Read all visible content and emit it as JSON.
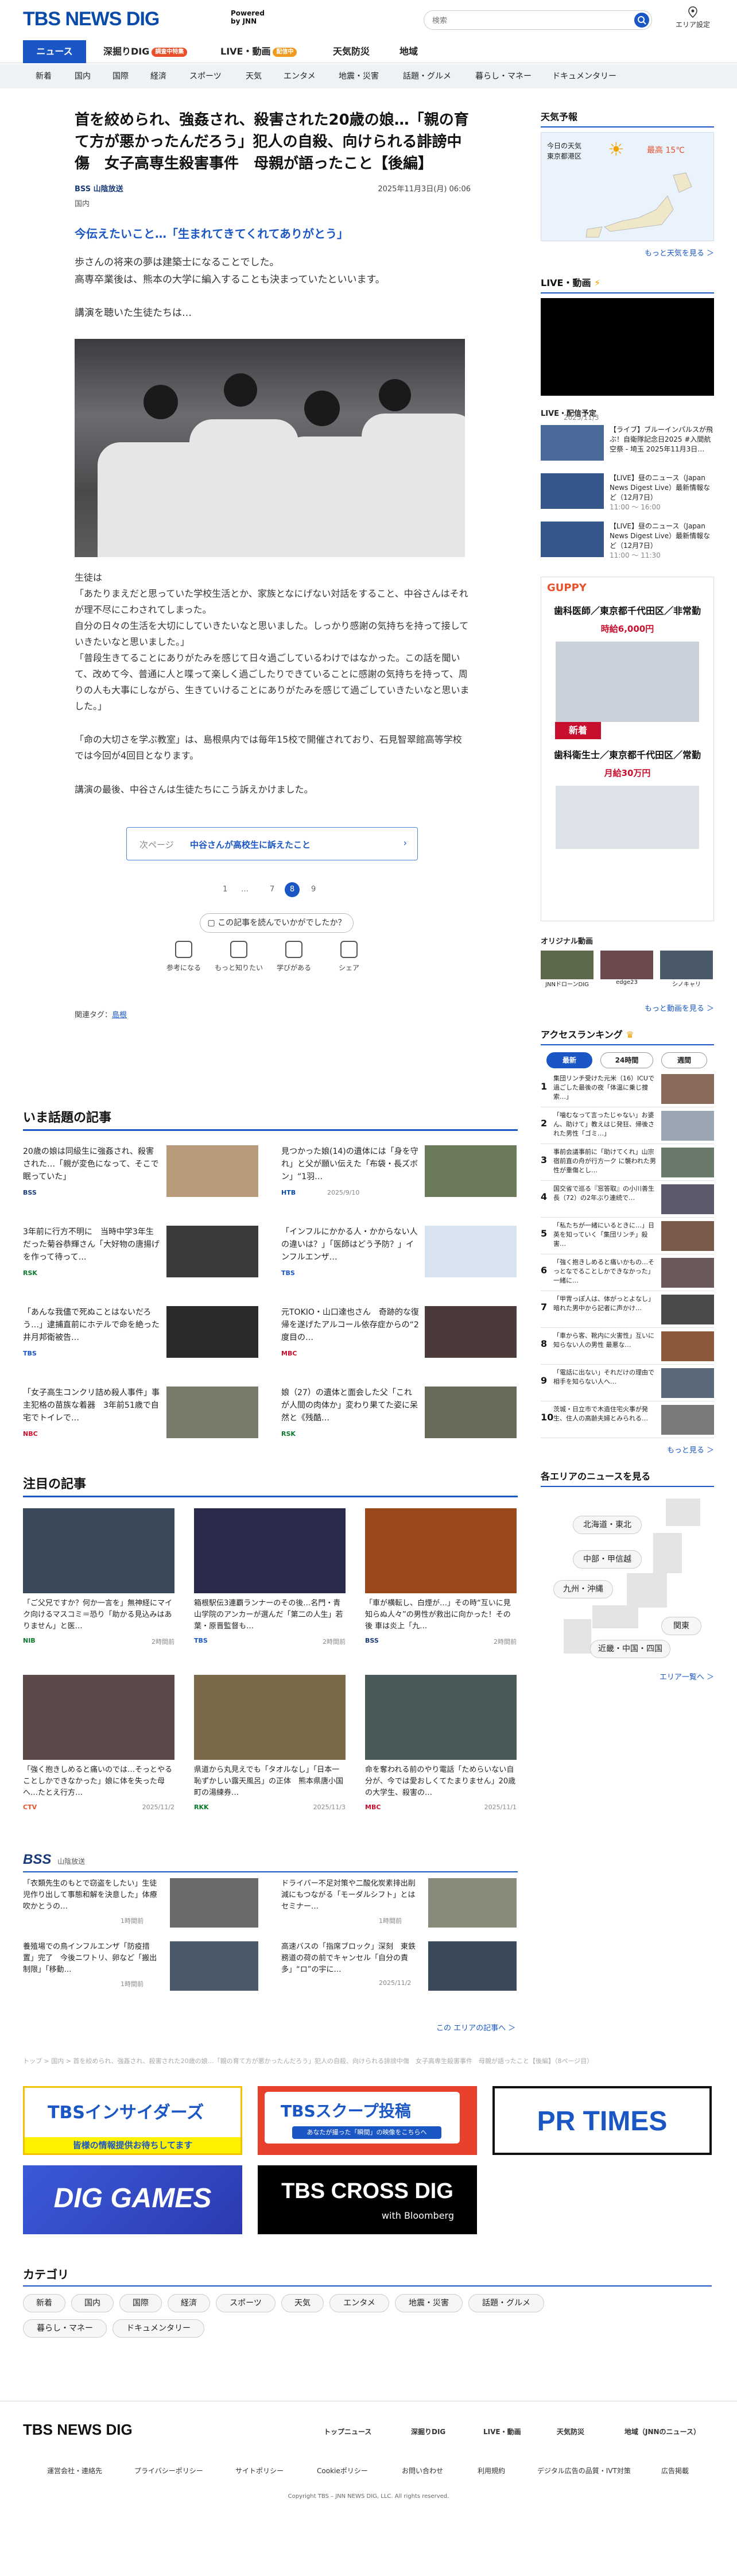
{
  "header": {
    "logo_main": "TBS NEWS DIG",
    "powered_label": "Powered\nby JNN",
    "search_placeholder": "検索",
    "area_setting": "エリア設定"
  },
  "gnav": [
    {
      "label": "ニュース",
      "badge": ""
    },
    {
      "label": "深掘りDIG",
      "badge": "調査中特集"
    },
    {
      "label": "LIVE・動画",
      "badge": "配信中"
    },
    {
      "label": "天気防災",
      "badge": ""
    },
    {
      "label": "地域",
      "badge": ""
    }
  ],
  "subnav": [
    "新着",
    "国内",
    "国際",
    "経済",
    "スポーツ",
    "天気",
    "エンタメ",
    "地震・災害",
    "話題・グルメ",
    "暮らし・マネー",
    "ドキュメンタリー"
  ],
  "article": {
    "title": "首を絞められ、強姦され、殺害された20歳の娘…「親の育て方が悪かったんだろう」犯人の自殺、向けられる誹謗中傷　女子高専生殺害事件　母親が語ったこと【後編】",
    "source": "BSS 山陰放送",
    "date": "2025年11月3日(月) 06:06",
    "category": "国内",
    "subhead": "今伝えたいこと…「生まれてきてくれてありがとう」",
    "para1": "歩さんの将来の夢は建築士になることでした。\n高専卒業後は、熊本の大学に編入することも決まっていたといいます。",
    "para2": "講演を聴いた生徒たちは…",
    "para3": "生徒は\n「あたりまえだと思っていた学校生活とか、家族となにげない対話をすること、中谷さんはそれが理不尽にこわされてしまった。\n自分の日々の生活を大切にしていきたいなと思いました。しっかり感謝の気持ちを持って接していきたいなと思いました。」\n「普段生きてることにありがたみを感じて日々過ごしているわけではなかった。この話を聞いて、改めて今、普通に人と喋って楽しく過ごしたりできていることに感謝の気持ちを持って、周りの人も大事にしながら、生きていけることにありがたみを感じて過ごしていきたいなと思いました。」",
    "para4": "「命の大切さを学ぶ教室」は、島根県内では毎年15校で開催されており、石見智翠館高等学校では今回が4回目となります。",
    "para5": "講演の最後、中谷さんは生徒たちにこう訴えかけました。",
    "next_label": "次ページ",
    "next_text": "中谷さんが高校生に訴えたこと",
    "pager": [
      "1",
      "…",
      "7",
      "8",
      "9"
    ],
    "pager_current": "8",
    "ask": "この記事を読んでいかがでしたか？",
    "reactions": [
      "参考になる",
      "もっと知りたい",
      "学びがある",
      "シェア"
    ],
    "tag_label": "関連タグ：",
    "tag": "島根"
  },
  "sections": {
    "trending": "いま話題の記事",
    "featured": "注目の記事",
    "bss": "BSS",
    "bss_sub": "山陰放送",
    "area_more": "この エリアの記事へ ＞",
    "categories": "カテゴリ"
  },
  "trending": [
    {
      "title": "20歳の娘は同級生に強姦され、殺害された…「親が変色になって、そこで眠っていた」",
      "src": "BSS",
      "date": "2025/11/3"
    },
    {
      "title": "見つかった娘(14)の遺体には「身を守れ」と父が願い伝えた「布袋・長ズボン」“1羽…",
      "src": "HTB",
      "date": "2025/9/10"
    },
    {
      "title": "3年前に行方不明に　当時中学3年生だった菊谷恭輝さん「大好物の唐揚げを作って待って…",
      "src": "RSK",
      "date": "2025/11/1"
    },
    {
      "title": "「インフルにかかる人・かからない人の違いは？」「医師はどう予防？」インフルエンザ…",
      "src": "TBS",
      "date": "2025/11/1"
    },
    {
      "title": "「あんな我儘で死ぬことはないだろう…」逮捕直前にホテルで命を絶った井月邦衛被告…",
      "src": "TBS",
      "date": "2025/10/29"
    },
    {
      "title": "元TOKIO・山口達也さん　奇跡的な復帰を遂げたアルコール依存症からの“2度目の…",
      "src": "MBC",
      "date": "2025/11/1"
    },
    {
      "title": "「女子高生コンクリ詰め殺人事件」事主犯格の苗族な着器　3年前51歳で自宅でトイレで…",
      "src": "NBC",
      "date": "2025/11/1"
    },
    {
      "title": "娘（27）の遺体と面会した父「これが人間の肉体か」変わり果てた姿に呆然と《残酷…",
      "src": "RSK",
      "date": "2025/11/3"
    }
  ],
  "featured": [
    {
      "title": "「ご父兄ですか？何か一言を」無神経にマイク向けるマスコミ＝恐り「助かる見込みはありません」と医…",
      "src": "NIB",
      "date": "2時間前"
    },
    {
      "title": "箱根駅伝3連覇ランナーのその後…名門・青山学院のアンカーが選んだ「第二の人生」若葉・原晋監督も…",
      "src": "TBS",
      "date": "2時間前"
    },
    {
      "title": "「車が横転し、白煙が…」その時“互いに見知らぬ人々”の男性が救出に向かった！その後 車は炎上「九…",
      "src": "BSS",
      "date": "2時間前"
    },
    {
      "title": "「強く抱きしめると痛いのでは…そっとやることしかできなかった」娘に体を失った母へ…たとえ行方…",
      "src": "CTV",
      "date": "2025/11/2"
    },
    {
      "title": "県道から丸見えでも「タオルなし」「日本一恥ずかしい露天風呂」の正体　熊本県唐小国町の湯練券…",
      "src": "RKK",
      "date": "2025/11/3"
    },
    {
      "title": "命を奪われる前のやり電話「ためらいない自分が、今では愛おしくてたまりません」20歳の大学生、殺害の…",
      "src": "MBC",
      "date": "2025/11/1"
    }
  ],
  "bss_news": [
    {
      "title": "「衣類先生のもとで窃盗をしたい」生徒児作り出して事態和解を決意した」体療吹かとうの…",
      "date": "1時間前"
    },
    {
      "title": "ドライバー不足対策や二酸化炭素排出削減にもつながる「モーダルシフト」とは　セミナー…",
      "date": "1時間前"
    },
    {
      "title": "養殖場での鳥インフルエンザ「防疫措置」完了　今後ニワトリ、卵など「搬出制限」「移動…",
      "date": "1時間前"
    },
    {
      "title": "高速バスの「指席ブロック」深刻　東鉄務道の荷の前でキャンセル「自分の責多」“ロ”の宇に…",
      "date": "2025/11/2"
    }
  ],
  "sidebar": {
    "weather_title": "天気予報",
    "weather_today": "今日の天気",
    "weather_area": "東京都港区",
    "weather_temp": "最高 15℃",
    "weather_more": "もっと天気を見る ＞",
    "live_title": "LIVE・動画",
    "live_schedule": "LIVE・配信予定",
    "live_items": [
      {
        "title": "【ライブ】ブルーインパルスが飛ぶ！自衛隊記念日2025 #入間航空祭 - 埼玉 2025年11月3日…",
        "time": "2025/11/3"
      },
      {
        "title": "【LIVE】昼のニュース（Japan News Digest Live）最新情報など（12月7日）",
        "time": "11:00 ～ 16:00"
      },
      {
        "title": "【LIVE】昼のニュース（Japan News Digest Live）最新情報など（12月7日）",
        "time": "11:00 ～ 11:30"
      }
    ],
    "ad_company": "GUPPY",
    "ad_title1": "歯科医師／東京都千代田区／非常勤",
    "ad_wage1": "時給6,000円",
    "ad_new": "新着",
    "ad_title2": "歯科衛生士／東京都千代田区／常勤",
    "ad_wage2": "月給30万円",
    "original_title": "オリジナル動画",
    "original_items": [
      "JNNドローンDIG",
      "edge23",
      "シノキャリ"
    ],
    "video_more": "もっと動画を見る ＞",
    "ranking_title": "アクセスランキング",
    "ranking_tabs": [
      "最新",
      "24時間",
      "週間"
    ],
    "ranking": [
      {
        "n": "1",
        "title": "集団リンチ受けた元米（16）ICUで過ごした最後の夜「体温に乗じ捜索…」"
      },
      {
        "n": "2",
        "title": "「噛むなって言ったじゃない」お婆ん、助けて」教えはじ発狂、帰後された男性「ゴミ…」"
      },
      {
        "n": "3",
        "title": "事前会議事前に「助けてくれ」山宗　宿前直の舟が行方一ク に襲われた男性が重傷とし…"
      },
      {
        "n": "4",
        "title": "国交省で巡る『窓答取』の小川善生長（72）の2年ぶり連続で…"
      },
      {
        "n": "5",
        "title": "「私たちが一緒にいるときに…」日英を知っていく「集団リンチ」殺害…"
      },
      {
        "n": "6",
        "title": "「強く抱きしめると痛いかもの…そっとなでることしかできなかった」一緒に…"
      },
      {
        "n": "7",
        "title": "「甲冑っぽ人は、体がっとよなし」暗れた男中から記者に声かけ…"
      },
      {
        "n": "8",
        "title": "「車から客、靴内に火害性」互いに知らない人の男性 最悪な…"
      },
      {
        "n": "9",
        "title": "「電話に出ない」それだけの理由で相手を知らない人へ…"
      },
      {
        "n": "10",
        "title": "茨城・日立市で木造住宅火事が発生、住人の高齢夫婦とみられる…"
      }
    ],
    "ranking_more": "もっと見る ＞",
    "area_title": "各エリアのニュースを見る",
    "area_buttons": [
      "北海道・東北",
      "中部・甲信越",
      "九州・沖縄",
      "関東",
      "近畿・中国・四国"
    ],
    "area_more": "エリア一覧へ ＞"
  },
  "breadcrumb": "トップ > 国内 > 首を絞められ、強姦され、殺害された20歳の娘…「親の育て方が悪かったんだろう」犯人の自殺、向けられる誹謗中傷　女子高専生殺害事件　母親が語ったこと【後編】（8ページ目）",
  "banners": [
    {
      "title": "TBSインサイダーズ",
      "sub": "皆様の情報提供お待ちしてます"
    },
    {
      "title": "TBSスクープ投稿",
      "sub": "あなたが撮った「瞬間」の映像をこちらへ"
    },
    {
      "title": "PR TIMES",
      "sub": ""
    },
    {
      "title": "DIG GAMES",
      "sub": ""
    },
    {
      "title": "TBS CROSS DIG",
      "sub": "with Bloomberg"
    }
  ],
  "categories": [
    "新着",
    "国内",
    "国際",
    "経済",
    "スポーツ",
    "天気",
    "エンタメ",
    "地震・災害",
    "話題・グルメ",
    "暮らし・マネー",
    "ドキュメンタリー"
  ],
  "footer": {
    "nav": [
      "トップニュース",
      "深掘りDIG",
      "LIVE・動画",
      "天気防災",
      "地域（JNNのニュース）"
    ],
    "links": [
      "運営会社・連絡先",
      "プライバシーポリシー",
      "サイトポリシー",
      "Cookieポリシー",
      "お問い合わせ",
      "利用規約",
      "デジタル広告の品質・IVT対策",
      "広告掲載"
    ],
    "copyright": "Copyright TBS – JNN NEWS DIG, LLC. All rights reserved."
  },
  "colors": {
    "brand": "#1a56c4",
    "accent_orange": "#e8502a",
    "ad_red": "#c8102e"
  }
}
